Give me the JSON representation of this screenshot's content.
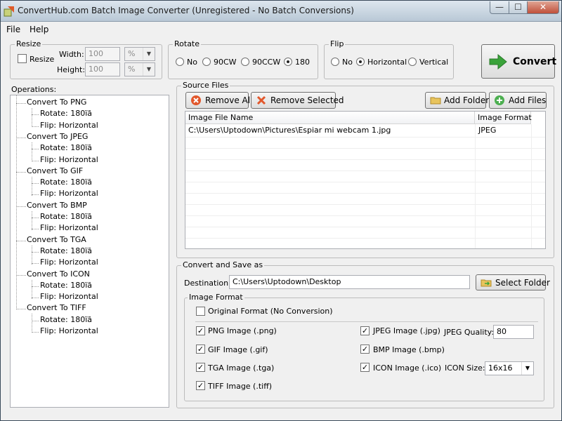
{
  "window": {
    "title": "ConvertHub.com Batch Image Converter (Unregistered - No Batch Conversions)",
    "min_glyph": "—",
    "max_glyph": "☐",
    "close_glyph": "✕"
  },
  "menu": {
    "file": "File",
    "help": "Help"
  },
  "resize": {
    "title": "Resize",
    "checkbox_label": "Resize",
    "width_label": "Width:",
    "width_value": "100",
    "width_unit": "%",
    "height_label": "Height:",
    "height_value": "100",
    "height_unit": "%"
  },
  "rotate": {
    "title": "Rotate",
    "options": [
      "No",
      "90CW",
      "90CCW",
      "180"
    ],
    "selected": "180"
  },
  "flip": {
    "title": "Flip",
    "options": [
      "No",
      "Horizontal",
      "Vertical"
    ],
    "selected": "Horizontal"
  },
  "convert_button": "Convert",
  "operations": {
    "label": "Operations:",
    "items": [
      {
        "name": "Convert To PNG",
        "rotate": "Rotate: 180ïã",
        "flip": "Flip: Horizontal"
      },
      {
        "name": "Convert To JPEG",
        "rotate": "Rotate: 180ïã",
        "flip": "Flip: Horizontal"
      },
      {
        "name": "Convert To GIF",
        "rotate": "Rotate: 180ïã",
        "flip": "Flip: Horizontal"
      },
      {
        "name": "Convert To BMP",
        "rotate": "Rotate: 180ïã",
        "flip": "Flip: Horizontal"
      },
      {
        "name": "Convert To TGA",
        "rotate": "Rotate: 180ïã",
        "flip": "Flip: Horizontal"
      },
      {
        "name": "Convert To ICON",
        "rotate": "Rotate: 180ïã",
        "flip": "Flip: Horizontal"
      },
      {
        "name": "Convert To TIFF",
        "rotate": "Rotate: 180ïã",
        "flip": "Flip: Horizontal"
      }
    ]
  },
  "source_files": {
    "title": "Source Files",
    "remove_all": "Remove All",
    "remove_selected": "Remove Selected",
    "add_folder": "Add Folder",
    "add_files": "Add Files",
    "columns": [
      "Image File Name",
      "Image Format"
    ],
    "rows": [
      {
        "file": "C:\\Users\\Uptodown\\Pictures\\Espiar mi webcam 1.jpg",
        "format": "JPEG"
      }
    ]
  },
  "save": {
    "title": "Convert and Save as",
    "destination_label": "Destination:",
    "destination_value": "C:\\Users\\Uptodown\\Desktop",
    "select_folder": "Select Folder",
    "format_group": "Image Format",
    "original_format": "Original Format (No Conversion)",
    "png": "PNG Image (.png)",
    "gif": "GIF Image (.gif)",
    "tga": "TGA Image (.tga)",
    "tiff": "TIFF Image (.tiff)",
    "jpeg": "JPEG Image (.jpg)",
    "bmp": "BMP Image (.bmp)",
    "icon": "ICON Image (.ico)",
    "jpeg_quality_label": "JPEG Quality:",
    "jpeg_quality_value": "80",
    "icon_size_label": "ICON Size:",
    "icon_size_value": "16x16"
  },
  "check_glyph": "✓",
  "dropdown_glyph": "▼",
  "colors": {
    "convert_arrow": "#3aa33a",
    "remove_icon": "#e2572b",
    "add_icon": "#4caf50",
    "folder_icon": "#e8c45c"
  }
}
